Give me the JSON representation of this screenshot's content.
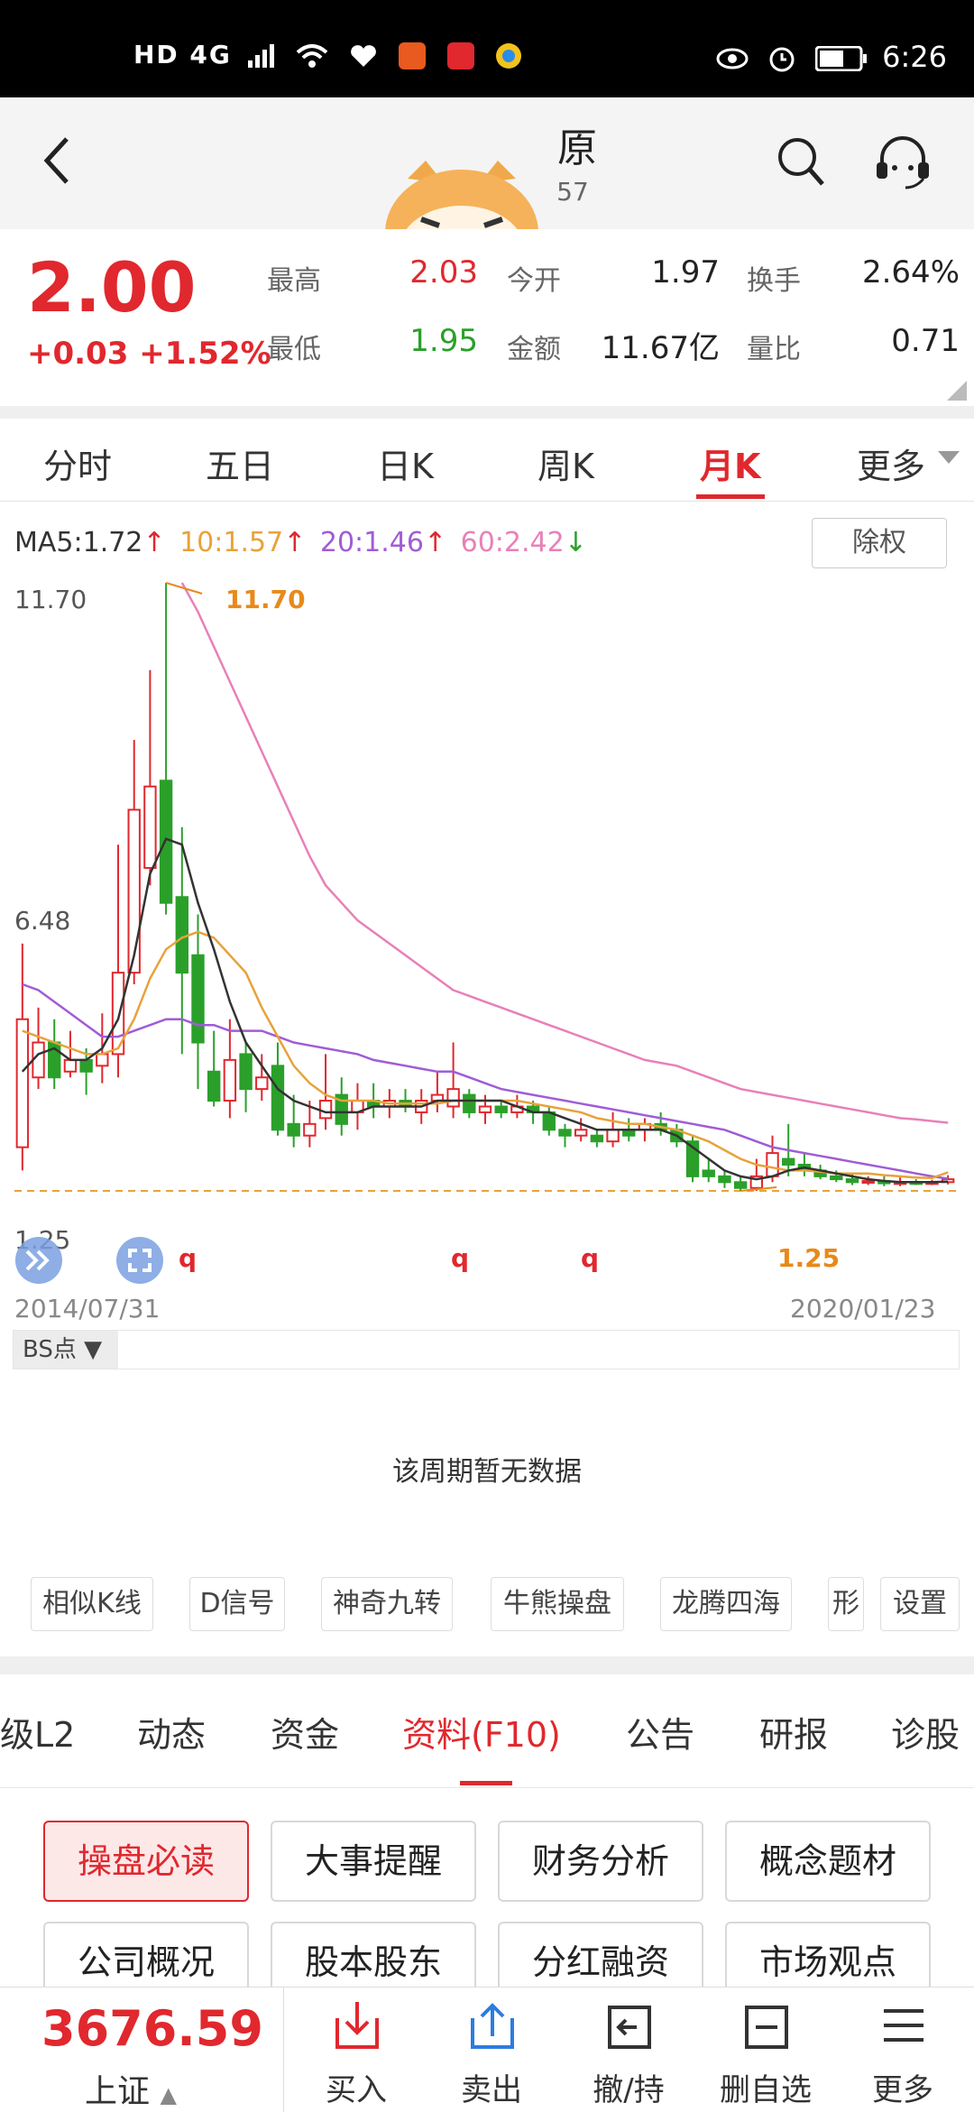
{
  "status": {
    "time": "6:26",
    "left_text": "HD 4G"
  },
  "nav": {
    "title": "原",
    "code": "57"
  },
  "quote": {
    "price": "2.00",
    "change": "+0.03 +1.52%",
    "labels": [
      "最高",
      "今开",
      "换手",
      "最低",
      "金额",
      "量比"
    ],
    "values": [
      "2.03",
      "1.97",
      "2.64%",
      "1.95",
      "11.67亿",
      "0.71"
    ]
  },
  "tabs": [
    "分时",
    "五日",
    "日K",
    "周K",
    "月K",
    "更多"
  ],
  "ma": {
    "ma5": "MA5:1.72",
    "ma10": "10:1.57",
    "ma20": "20:1.46",
    "ma60": "60:2.42",
    "arrow_up": "↑",
    "arrow_down": "↓",
    "ma5_color": "#333333",
    "ma10_color": "#e8a23a",
    "ma20_color": "#a05cd6",
    "ma60_color": "#e880b8"
  },
  "chuquan": "除权",
  "chart_data": {
    "type": "candlestick",
    "x_start": "2014/07/31",
    "x_end": "2020/01/23",
    "y_ticks": [
      "11.70",
      "6.48",
      "1.25"
    ],
    "max_label": "11.70",
    "min_label": "1.25",
    "ref_price": 1.25,
    "ylim": [
      1.25,
      11.7
    ],
    "candles": [
      [
        2.0,
        4.2,
        5.5,
        1.6
      ],
      [
        3.2,
        3.8,
        4.4,
        3.0
      ],
      [
        3.8,
        3.2,
        4.2,
        3.0
      ],
      [
        3.3,
        3.5,
        4.0,
        3.2
      ],
      [
        3.5,
        3.3,
        3.7,
        2.9
      ],
      [
        3.4,
        3.6,
        4.3,
        3.1
      ],
      [
        3.6,
        5.0,
        7.2,
        3.2
      ],
      [
        5.0,
        7.8,
        9.0,
        4.8
      ],
      [
        6.8,
        8.2,
        10.2,
        6.5
      ],
      [
        8.3,
        6.2,
        11.7,
        6.0
      ],
      [
        6.3,
        5.0,
        7.5,
        3.6
      ],
      [
        5.3,
        3.8,
        6.0,
        3.0
      ],
      [
        3.3,
        2.8,
        4.0,
        2.7
      ],
      [
        2.8,
        3.5,
        4.2,
        2.5
      ],
      [
        3.6,
        3.0,
        3.8,
        2.6
      ],
      [
        3.0,
        3.2,
        3.6,
        2.8
      ],
      [
        3.4,
        2.3,
        3.8,
        2.2
      ],
      [
        2.4,
        2.2,
        2.9,
        2.0
      ],
      [
        2.2,
        2.4,
        2.8,
        2.0
      ],
      [
        2.5,
        2.8,
        3.6,
        2.3
      ],
      [
        2.9,
        2.4,
        3.2,
        2.2
      ],
      [
        2.6,
        2.8,
        3.1,
        2.3
      ],
      [
        2.8,
        2.7,
        3.1,
        2.5
      ],
      [
        2.7,
        2.8,
        3.0,
        2.5
      ],
      [
        2.8,
        2.7,
        3.0,
        2.6
      ],
      [
        2.6,
        2.8,
        3.0,
        2.4
      ],
      [
        2.8,
        2.9,
        3.3,
        2.6
      ],
      [
        2.7,
        3.0,
        3.8,
        2.5
      ],
      [
        2.9,
        2.6,
        3.0,
        2.5
      ],
      [
        2.6,
        2.7,
        2.9,
        2.4
      ],
      [
        2.7,
        2.6,
        2.8,
        2.5
      ],
      [
        2.6,
        2.7,
        2.9,
        2.5
      ],
      [
        2.7,
        2.6,
        2.8,
        2.4
      ],
      [
        2.6,
        2.3,
        2.7,
        2.2
      ],
      [
        2.3,
        2.2,
        2.4,
        2.0
      ],
      [
        2.2,
        2.3,
        2.5,
        2.1
      ],
      [
        2.2,
        2.1,
        2.3,
        2.0
      ],
      [
        2.1,
        2.3,
        2.6,
        2.0
      ],
      [
        2.3,
        2.2,
        2.5,
        2.1
      ],
      [
        2.3,
        2.4,
        2.5,
        2.1
      ],
      [
        2.4,
        2.3,
        2.6,
        2.2
      ],
      [
        2.3,
        2.1,
        2.4,
        2.0
      ],
      [
        2.1,
        1.5,
        2.2,
        1.4
      ],
      [
        1.6,
        1.5,
        1.8,
        1.4
      ],
      [
        1.5,
        1.4,
        1.6,
        1.3
      ],
      [
        1.4,
        1.3,
        1.5,
        1.25
      ],
      [
        1.3,
        1.5,
        1.8,
        1.25
      ],
      [
        1.5,
        1.9,
        2.2,
        1.4
      ],
      [
        1.8,
        1.7,
        2.4,
        1.5
      ],
      [
        1.7,
        1.6,
        1.9,
        1.5
      ],
      [
        1.6,
        1.5,
        1.7,
        1.45
      ],
      [
        1.5,
        1.45,
        1.6,
        1.4
      ],
      [
        1.45,
        1.4,
        1.55,
        1.35
      ],
      [
        1.4,
        1.42,
        1.5,
        1.35
      ],
      [
        1.42,
        1.38,
        1.5,
        1.33
      ],
      [
        1.38,
        1.4,
        1.48,
        1.33
      ],
      [
        1.4,
        1.39,
        1.45,
        1.35
      ],
      [
        1.39,
        1.4,
        1.44,
        1.35
      ],
      [
        1.4,
        1.45,
        1.52,
        1.36
      ]
    ],
    "ma5": [
      3.3,
      3.6,
      3.7,
      3.5,
      3.5,
      3.7,
      4.2,
      5.3,
      6.7,
      7.3,
      7.2,
      6.2,
      5.4,
      4.5,
      3.8,
      3.4,
      3.0,
      2.8,
      2.7,
      2.6,
      2.6,
      2.6,
      2.7,
      2.7,
      2.7,
      2.7,
      2.8,
      2.8,
      2.8,
      2.8,
      2.8,
      2.7,
      2.6,
      2.6,
      2.5,
      2.4,
      2.3,
      2.3,
      2.3,
      2.3,
      2.3,
      2.2,
      2.0,
      1.8,
      1.6,
      1.5,
      1.45,
      1.5,
      1.6,
      1.65,
      1.6,
      1.55,
      1.5,
      1.45,
      1.42,
      1.4,
      1.4,
      1.4,
      1.41
    ],
    "ma10": [
      4.0,
      3.9,
      3.8,
      3.7,
      3.6,
      3.6,
      3.7,
      4.2,
      4.9,
      5.4,
      5.6,
      5.7,
      5.6,
      5.3,
      5.0,
      4.4,
      3.9,
      3.4,
      3.1,
      2.9,
      2.8,
      2.8,
      2.8,
      2.75,
      2.75,
      2.75,
      2.75,
      2.8,
      2.8,
      2.8,
      2.8,
      2.8,
      2.75,
      2.7,
      2.65,
      2.6,
      2.5,
      2.45,
      2.4,
      2.4,
      2.35,
      2.3,
      2.2,
      2.1,
      1.95,
      1.8,
      1.7,
      1.65,
      1.6,
      1.6,
      1.58,
      1.55,
      1.55,
      1.55,
      1.52,
      1.5,
      1.48,
      1.47,
      1.57
    ],
    "ma20": [
      4.8,
      4.7,
      4.5,
      4.3,
      4.1,
      3.9,
      3.9,
      4.0,
      4.1,
      4.2,
      4.2,
      4.1,
      4.1,
      4.0,
      4.0,
      4.0,
      3.9,
      3.8,
      3.75,
      3.7,
      3.65,
      3.6,
      3.5,
      3.45,
      3.4,
      3.35,
      3.3,
      3.3,
      3.2,
      3.1,
      3.0,
      2.95,
      2.9,
      2.85,
      2.8,
      2.75,
      2.7,
      2.65,
      2.6,
      2.55,
      2.5,
      2.45,
      2.4,
      2.35,
      2.3,
      2.2,
      2.1,
      2.0,
      1.95,
      1.9,
      1.85,
      1.8,
      1.75,
      1.7,
      1.65,
      1.6,
      1.55,
      1.5,
      1.46
    ],
    "ma60": [
      null,
      null,
      null,
      null,
      null,
      null,
      null,
      null,
      null,
      null,
      11.7,
      11.2,
      10.6,
      10.0,
      9.4,
      8.8,
      8.2,
      7.6,
      7.0,
      6.5,
      6.2,
      5.9,
      5.7,
      5.5,
      5.3,
      5.1,
      4.9,
      4.7,
      4.6,
      4.5,
      4.4,
      4.3,
      4.2,
      4.1,
      4.0,
      3.9,
      3.8,
      3.7,
      3.6,
      3.5,
      3.45,
      3.4,
      3.3,
      3.2,
      3.1,
      3.0,
      2.95,
      2.9,
      2.85,
      2.8,
      2.75,
      2.7,
      2.65,
      2.6,
      2.55,
      2.5,
      2.48,
      2.45,
      2.42
    ]
  },
  "markers": [
    "q",
    "q",
    "q"
  ],
  "bs": {
    "label": "BS点 ▼",
    "nodata": "该周期暂无数据"
  },
  "tools": [
    "相似K线",
    "D信号",
    "神奇九转",
    "牛熊操盘",
    "龙腾四海",
    "形",
    "设置"
  ],
  "ftabs": [
    "级L2",
    "动态",
    "资金",
    "资料(F10)",
    "公告",
    "研报",
    "诊股"
  ],
  "buttons": [
    [
      "操盘必读",
      "大事提醒",
      "财务分析",
      "概念题材"
    ],
    [
      "公司概况",
      "股本股东",
      "分红融资",
      "市场观点"
    ]
  ],
  "bottom": {
    "index": "3676.59",
    "index_name": "上证",
    "arrow": "▲",
    "actions": [
      "买入",
      "卖出",
      "撤/持",
      "删自选",
      "更多"
    ]
  },
  "colors": {
    "up": "#e0282e",
    "down": "#2aa02a",
    "accent": "#e0282e"
  }
}
